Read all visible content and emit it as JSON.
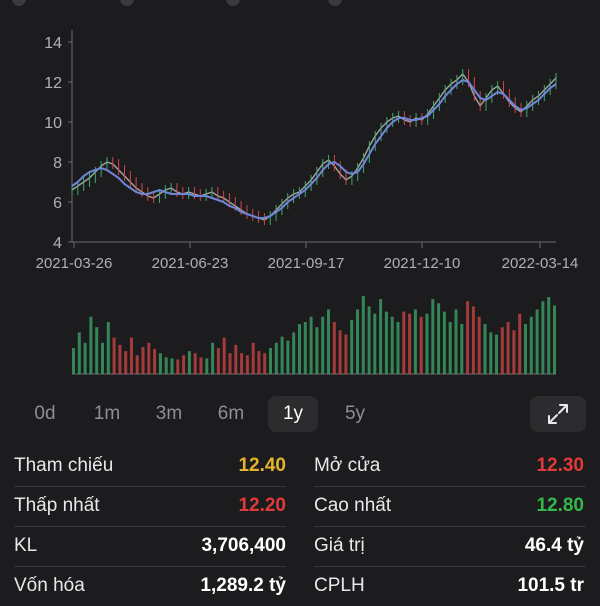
{
  "chart_data": {
    "type": "line",
    "x_tick_labels": [
      "2021-03-26",
      "2021-06-23",
      "2021-09-17",
      "2021-12-10",
      "2022-03-14"
    ],
    "y_tick_labels": [
      "4",
      "6",
      "8",
      "10",
      "12",
      "14"
    ],
    "ylim": [
      4,
      14.4
    ],
    "grid": false,
    "series": [
      {
        "values": [
          6.6,
          6.8,
          7.0,
          7.2,
          7.5,
          7.8,
          8.0,
          7.9,
          7.6,
          7.3,
          7.0,
          6.7,
          6.5,
          6.3,
          6.2,
          6.4,
          6.6,
          6.7,
          6.5,
          6.4,
          6.5,
          6.4,
          6.3,
          6.4,
          6.5,
          6.3,
          6.2,
          6.0,
          5.8,
          5.6,
          5.4,
          5.3,
          5.2,
          5.1,
          5.3,
          5.6,
          5.9,
          6.2,
          6.4,
          6.5,
          6.8,
          7.1,
          7.5,
          7.9,
          8.1,
          7.8,
          7.4,
          7.1,
          7.3,
          7.7,
          8.2,
          8.8,
          9.3,
          9.7,
          10.0,
          10.2,
          10.3,
          10.1,
          10.0,
          10.2,
          10.1,
          10.4,
          10.8,
          11.2,
          11.6,
          11.9,
          12.1,
          12.4,
          12.0,
          11.3,
          10.8,
          11.2,
          11.6,
          11.8,
          11.4,
          11.0,
          10.7,
          10.5,
          10.8,
          11.1,
          11.3,
          11.6,
          11.9,
          12.2
        ]
      },
      {
        "values": [
          6.8,
          7.0,
          7.3,
          7.5,
          7.6,
          7.7,
          7.6,
          7.4,
          7.2,
          6.9,
          6.7,
          6.5,
          6.4,
          6.4,
          6.5,
          6.6,
          6.5,
          6.4,
          6.4,
          6.4,
          6.4,
          6.3,
          6.3,
          6.3,
          6.2,
          6.1,
          6.0,
          5.8,
          5.7,
          5.5,
          5.4,
          5.3,
          5.2,
          5.2,
          5.3,
          5.5,
          5.7,
          6.0,
          6.2,
          6.4,
          6.6,
          6.9,
          7.2,
          7.6,
          7.9,
          8.0,
          7.8,
          7.5,
          7.4,
          7.5,
          7.9,
          8.4,
          8.9,
          9.3,
          9.7,
          10.0,
          10.2,
          10.2,
          10.1,
          10.1,
          10.2,
          10.3,
          10.6,
          10.9,
          11.3,
          11.6,
          11.9,
          12.1,
          12.0,
          11.6,
          11.2,
          11.1,
          11.3,
          11.5,
          11.4,
          11.1,
          10.8,
          10.6,
          10.7,
          10.9,
          11.1,
          11.4,
          11.7,
          11.9
        ]
      }
    ],
    "volume": [
      25,
      40,
      30,
      55,
      45,
      30,
      50,
      35,
      28,
      22,
      35,
      18,
      26,
      30,
      24,
      20,
      16,
      15,
      14,
      18,
      22,
      20,
      16,
      15,
      30,
      25,
      35,
      20,
      28,
      20,
      18,
      30,
      22,
      20,
      25,
      30,
      36,
      32,
      40,
      48,
      50,
      55,
      45,
      55,
      62,
      50,
      42,
      38,
      52,
      62,
      75,
      65,
      58,
      72,
      60,
      55,
      50,
      60,
      58,
      62,
      55,
      58,
      72,
      68,
      60,
      50,
      62,
      48,
      70,
      65,
      55,
      48,
      40,
      38,
      45,
      50,
      42,
      58,
      48,
      55,
      62,
      70,
      74,
      66
    ]
  },
  "ranges": [
    "0d",
    "1m",
    "3m",
    "6m",
    "1y",
    "5y"
  ],
  "active_range": "1y",
  "stats": {
    "rows": [
      {
        "left_label": "Tham chiếu",
        "left_value": "12.40",
        "right_label": "Mở cửa",
        "right_value": "12.30"
      },
      {
        "left_label": "Thấp nhất",
        "left_value": "12.20",
        "right_label": "Cao nhất",
        "right_value": "12.80"
      },
      {
        "left_label": "KL",
        "left_value": "3,706,400",
        "right_label": "Giá trị",
        "right_value": "46.4 tỷ"
      },
      {
        "left_label": "Vốn hóa",
        "left_value": "1,289.2 tỷ",
        "right_label": "CPLH",
        "right_value": "101.5 tr"
      }
    ]
  },
  "colors": {
    "background": "#1c1c1e",
    "price_line": "#c7c7c7",
    "ma_line": "#6e86d8",
    "up": "#3daa6a",
    "down": "#d24545",
    "reference": "#e7b42c",
    "decrease": "#e03a3a",
    "increase": "#34b84a",
    "neutral": "#ffffff"
  },
  "value_colors": [
    [
      "reference",
      "decrease"
    ],
    [
      "decrease",
      "increase"
    ],
    [
      "neutral",
      "neutral"
    ],
    [
      "neutral",
      "neutral"
    ]
  ],
  "icons": {
    "expand": "expand-arrows-icon"
  }
}
